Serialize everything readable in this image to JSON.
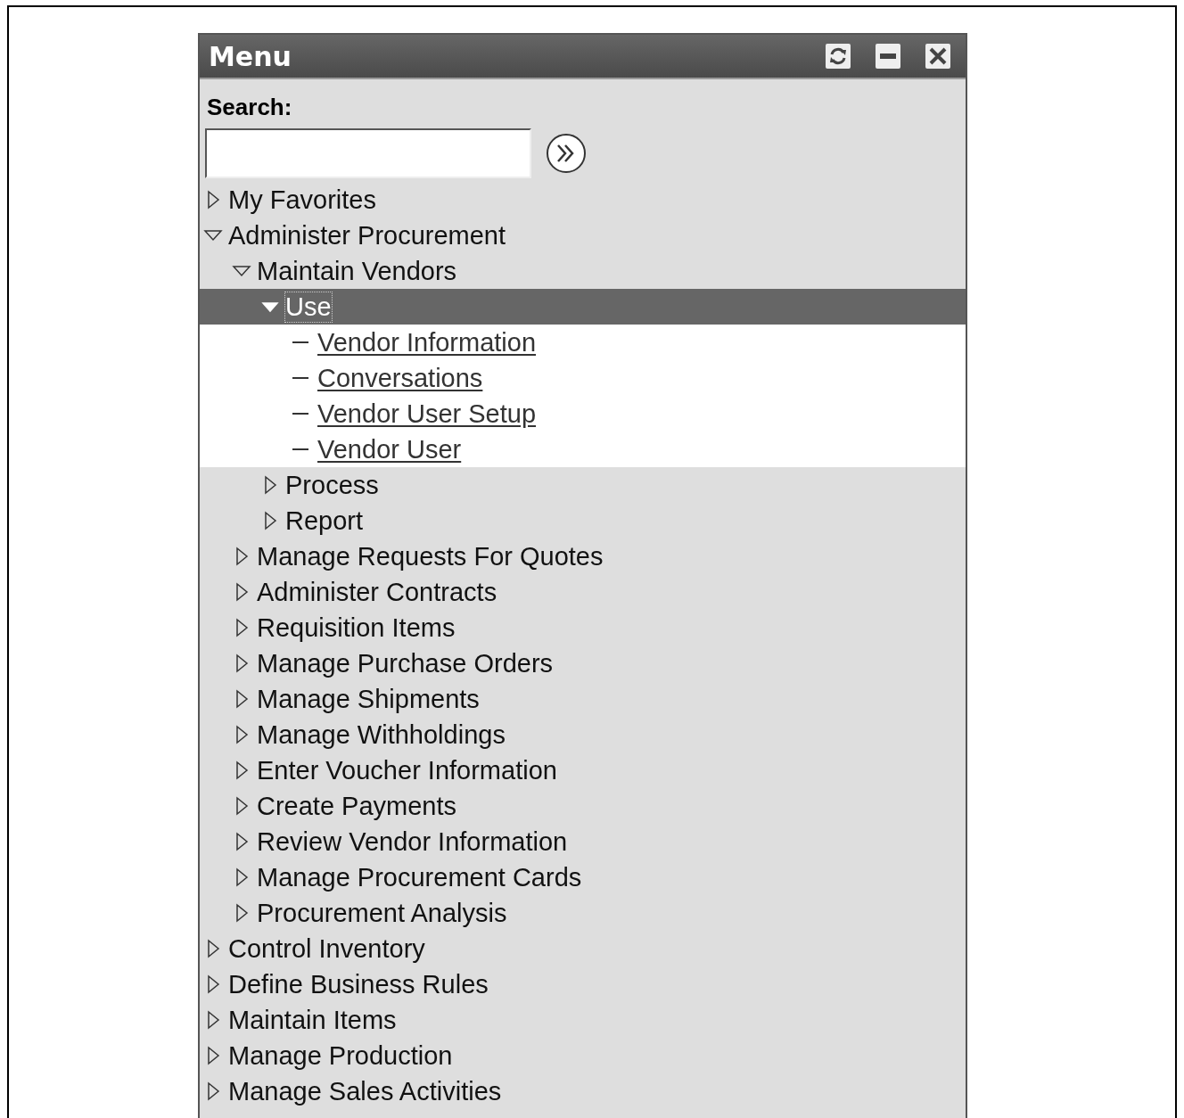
{
  "window": {
    "title": "Menu"
  },
  "search": {
    "label": "Search:"
  },
  "tree": [
    {
      "label": "My Favorites",
      "kind": "folder",
      "expanded": false,
      "selected": false
    },
    {
      "label": "Administer Procurement",
      "kind": "folder",
      "expanded": true,
      "selected": false,
      "children": [
        {
          "label": "Maintain Vendors",
          "kind": "folder",
          "expanded": true,
          "selected": false,
          "children": [
            {
              "label": "Use",
              "kind": "folder",
              "expanded": true,
              "selected": true,
              "children": [
                {
                  "label": "Vendor Information",
                  "kind": "link",
                  "selected": false
                },
                {
                  "label": "Conversations",
                  "kind": "link",
                  "selected": false
                },
                {
                  "label": "Vendor User Setup",
                  "kind": "link",
                  "selected": false
                },
                {
                  "label": "Vendor User",
                  "kind": "link",
                  "selected": false
                }
              ]
            },
            {
              "label": "Process",
              "kind": "folder",
              "expanded": false,
              "selected": false
            },
            {
              "label": "Report",
              "kind": "folder",
              "expanded": false,
              "selected": false
            }
          ]
        },
        {
          "label": "Manage Requests For Quotes",
          "kind": "folder",
          "expanded": false,
          "selected": false
        },
        {
          "label": "Administer Contracts",
          "kind": "folder",
          "expanded": false,
          "selected": false
        },
        {
          "label": "Requisition Items",
          "kind": "folder",
          "expanded": false,
          "selected": false
        },
        {
          "label": "Manage Purchase Orders",
          "kind": "folder",
          "expanded": false,
          "selected": false
        },
        {
          "label": "Manage Shipments",
          "kind": "folder",
          "expanded": false,
          "selected": false
        },
        {
          "label": "Manage Withholdings",
          "kind": "folder",
          "expanded": false,
          "selected": false
        },
        {
          "label": "Enter Voucher Information",
          "kind": "folder",
          "expanded": false,
          "selected": false
        },
        {
          "label": "Create Payments",
          "kind": "folder",
          "expanded": false,
          "selected": false
        },
        {
          "label": "Review Vendor Information",
          "kind": "folder",
          "expanded": false,
          "selected": false
        },
        {
          "label": "Manage Procurement Cards",
          "kind": "folder",
          "expanded": false,
          "selected": false
        },
        {
          "label": "Procurement Analysis",
          "kind": "folder",
          "expanded": false,
          "selected": false
        }
      ]
    },
    {
      "label": "Control Inventory",
      "kind": "folder",
      "expanded": false,
      "selected": false
    },
    {
      "label": "Define Business Rules",
      "kind": "folder",
      "expanded": false,
      "selected": false
    },
    {
      "label": "Maintain Items",
      "kind": "folder",
      "expanded": false,
      "selected": false
    },
    {
      "label": "Manage Production",
      "kind": "folder",
      "expanded": false,
      "selected": false
    },
    {
      "label": "Manage Sales Activities",
      "kind": "folder",
      "expanded": false,
      "selected": false
    }
  ]
}
